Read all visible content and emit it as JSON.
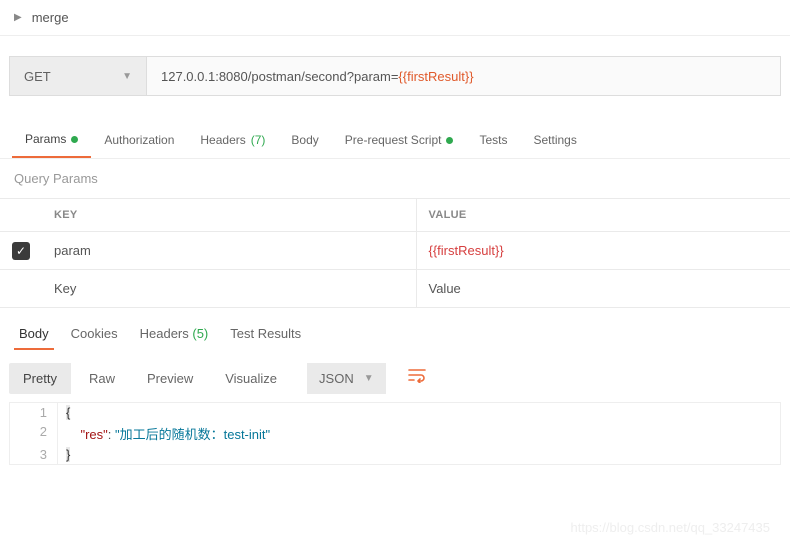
{
  "collapse": {
    "label": "merge"
  },
  "request": {
    "method": "GET",
    "url_prefix": "127.0.0.1:8080/postman/second?param=",
    "url_var": "{{firstResult}}"
  },
  "tabs": {
    "params": "Params",
    "auth": "Authorization",
    "headers": "Headers",
    "headers_count": "(7)",
    "body": "Body",
    "prereq": "Pre-request Script",
    "tests": "Tests",
    "settings": "Settings"
  },
  "query": {
    "title": "Query Params",
    "key_header": "KEY",
    "value_header": "VALUE",
    "row_key": "param",
    "row_value": "{{firstResult}}",
    "key_placeholder": "Key",
    "value_placeholder": "Value"
  },
  "response_tabs": {
    "body": "Body",
    "cookies": "Cookies",
    "headers": "Headers",
    "headers_count": "(5)",
    "tests": "Test Results"
  },
  "view": {
    "pretty": "Pretty",
    "raw": "Raw",
    "preview": "Preview",
    "visualize": "Visualize",
    "format": "JSON"
  },
  "code": {
    "l1": "{",
    "l2_indent": "    ",
    "l2_key": "\"res\"",
    "l2_sep": ": ",
    "l2_val": "\"加工后的随机数：test-init\"",
    "l3": "}"
  },
  "watermark": "https://blog.csdn.net/qq_33247435"
}
